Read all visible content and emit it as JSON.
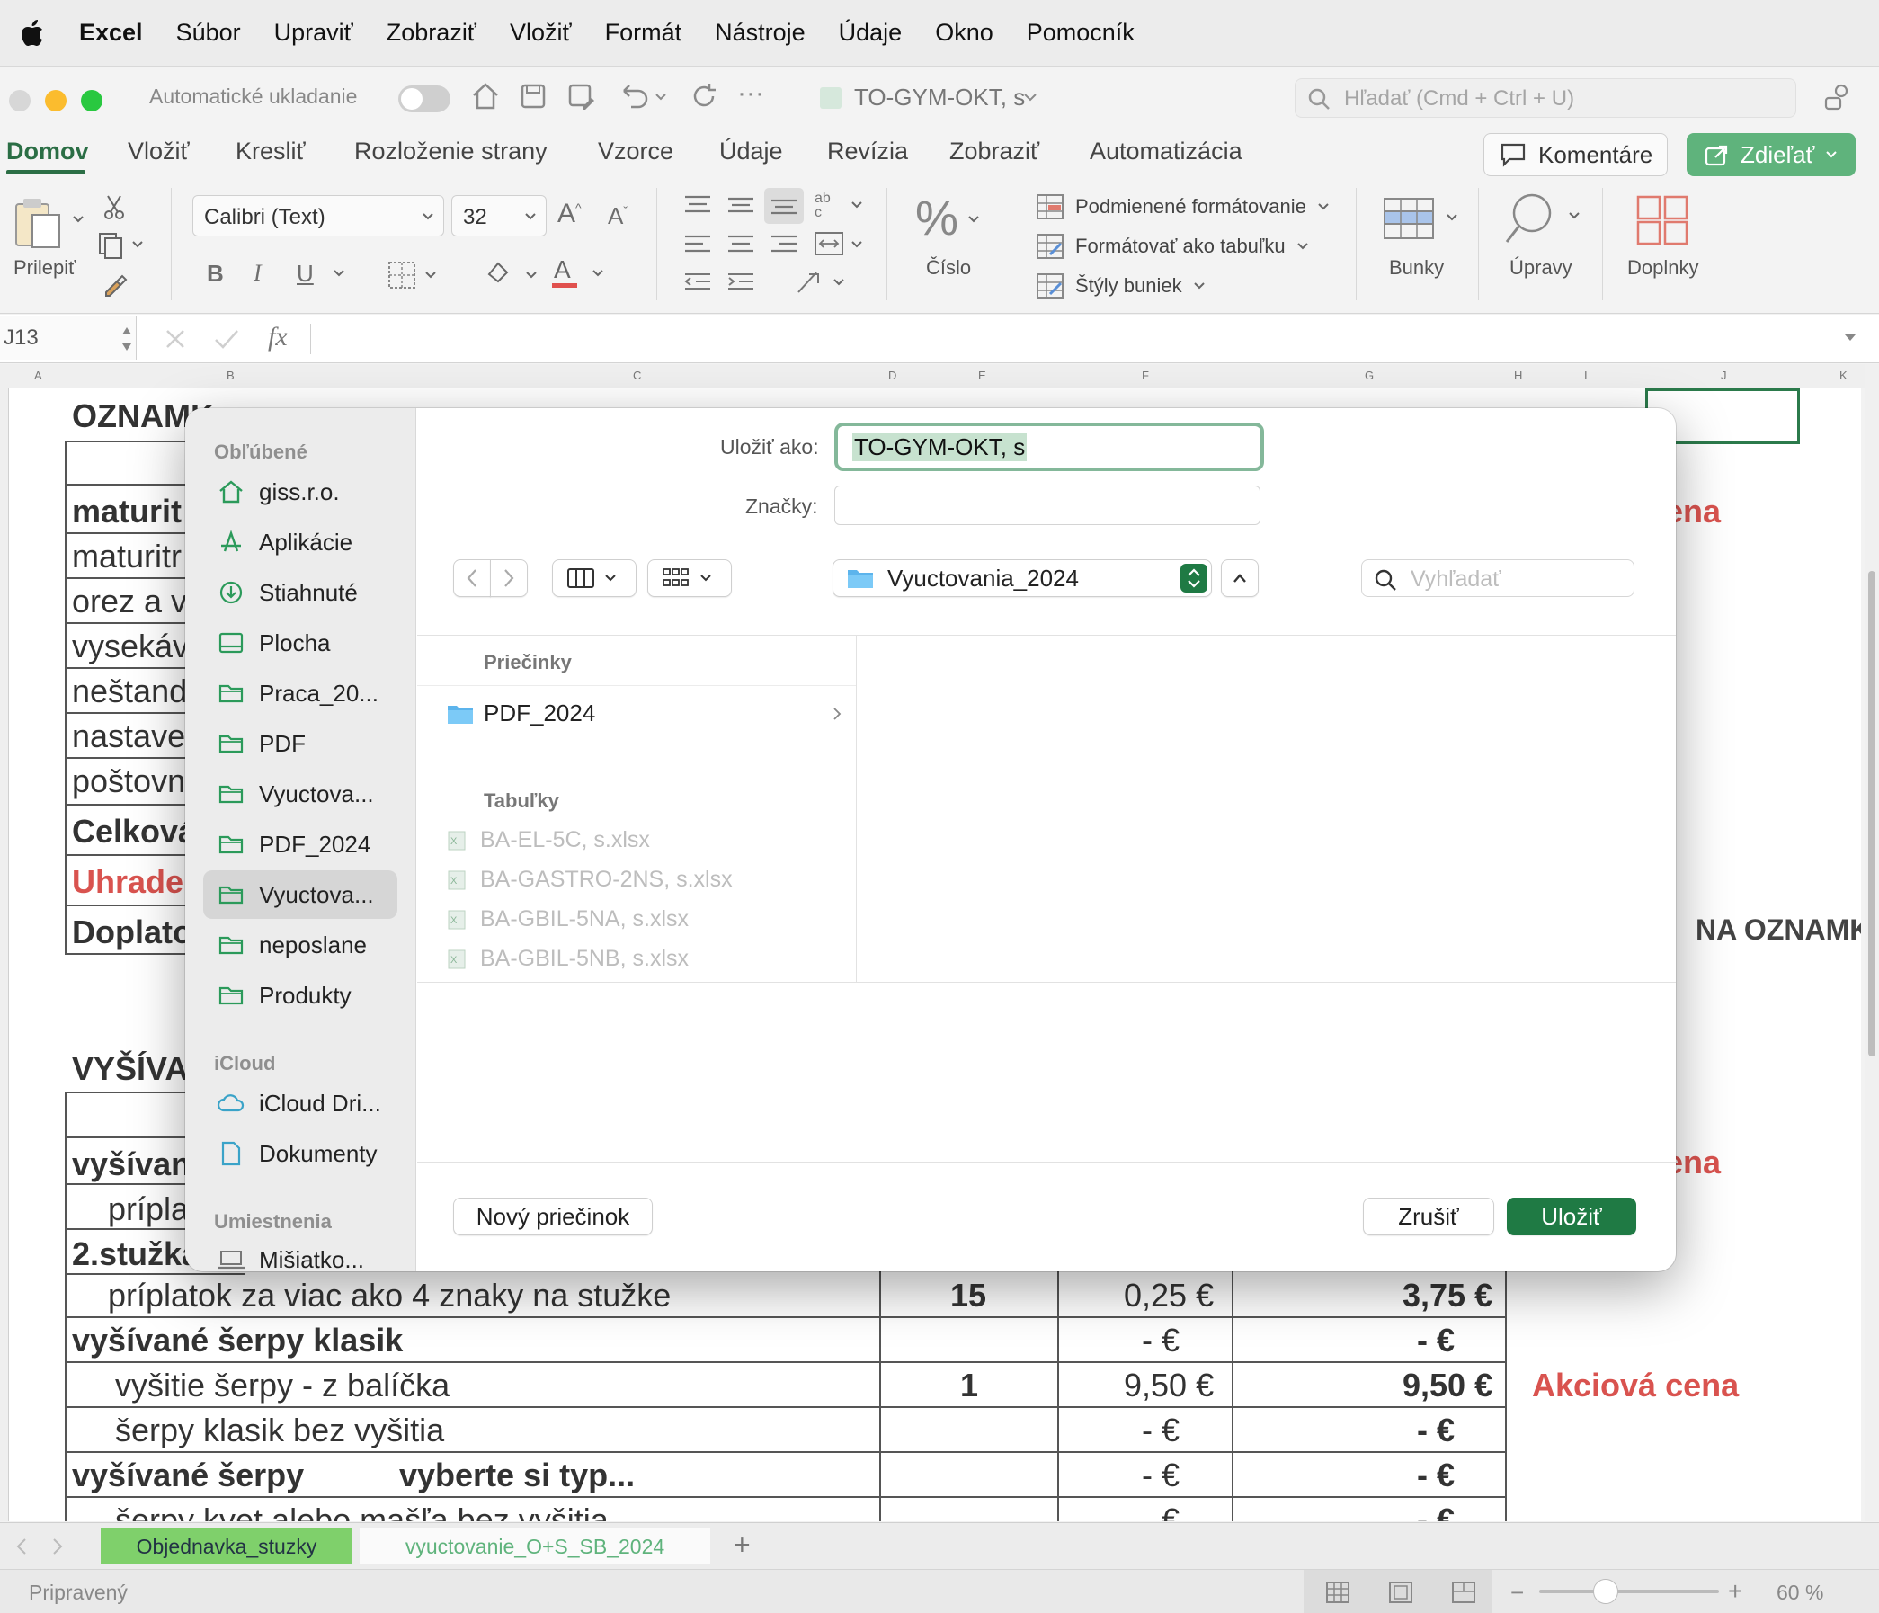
{
  "menubar": {
    "app": "Excel",
    "items": [
      "Súbor",
      "Upraviť",
      "Zobraziť",
      "Vložiť",
      "Formát",
      "Nástroje",
      "Údaje",
      "Okno",
      "Pomocník"
    ]
  },
  "titlebar": {
    "autosave_label": "Automatické ukladanie",
    "doc_title": "TO-GYM-OKT, s",
    "search_placeholder": "Hľadať (Cmd + Ctrl + U)"
  },
  "ribbon_tabs": [
    "Domov",
    "Vložiť",
    "Kresliť",
    "Rozloženie strany",
    "Vzorce",
    "Údaje",
    "Revízia",
    "Zobraziť",
    "Automatizácia"
  ],
  "ribbon": {
    "comments_label": "Komentáre",
    "share_label": "Zdieľať",
    "paste_label": "Prilepiť",
    "font_name": "Calibri (Text)",
    "font_size": "32",
    "number_label": "Číslo",
    "cond_format": "Podmienené formátovanie",
    "format_table": "Formátovať ako tabuľku",
    "cell_styles": "Štýly buniek",
    "cells_label": "Bunky",
    "edit_label": "Úpravy",
    "addins_label": "Doplnky",
    "bold": "B",
    "italic": "I",
    "underline": "U"
  },
  "formula_bar": {
    "cell_ref": "J13",
    "fx": "fx"
  },
  "columns": [
    "A",
    "B",
    "C",
    "D",
    "E",
    "F",
    "G",
    "H",
    "I",
    "J",
    "K"
  ],
  "sheet": {
    "title1": "OZNAMK",
    "left_rows": [
      "maturit",
      "maturitr",
      "orez a vl",
      "vysekáva",
      "neštand",
      "nastaver",
      "poštovn",
      "Celková",
      "Uhraden",
      "Doplato"
    ],
    "right_note1": "ena",
    "right_note2": "NA OZNAMK",
    "title2": "VYŠÍVA",
    "left_rows2": [
      "vyšívane",
      "prípla",
      "2.stužka"
    ],
    "right_note3": "ena",
    "rows": [
      {
        "label": "príplatok za viac ako 4 znaky na stužke",
        "qty": "15",
        "price": "0,25 €",
        "total": "3,75 €",
        "note": ""
      },
      {
        "label": "vyšívané šerpy klasik",
        "qty": "",
        "price": "-    €",
        "total": "-    €",
        "note": ""
      },
      {
        "label": "vyšitie šerpy - z balíčka",
        "qty": "1",
        "price": "9,50 €",
        "total": "9,50 €",
        "note": "Akciová cena"
      },
      {
        "label": "šerpy klasik bez vyšitia",
        "qty": "",
        "price": "-    €",
        "total": "-    €",
        "note": ""
      },
      {
        "label": "vyšívané šerpy",
        "label2": "vyberte si typ...",
        "qty": "",
        "price": "-    €",
        "total": "-    €",
        "note": ""
      },
      {
        "label": "šerpy kvet alebo mašľa bez vyšitia",
        "qty": "",
        "price": "-    €",
        "total": "-    €",
        "note": ""
      }
    ]
  },
  "sheet_tabs": [
    "Objednavka_stuzky",
    "vyuctovanie_O+S_SB_2024"
  ],
  "status": {
    "text": "Pripravený",
    "zoom": "60 %"
  },
  "dialog": {
    "save_as_label": "Uložiť ako:",
    "save_as_value": "TO-GYM-OKT, s",
    "tags_label": "Značky:",
    "location": "Vyuctovania_2024",
    "search_placeholder": "Vyhľadať",
    "sidebar": {
      "favorites_header": "Obľúbené",
      "favorites": [
        "giss.r.o.",
        "Aplikácie",
        "Stiahnuté",
        "Plocha",
        "Praca_20...",
        "PDF",
        "Vyuctova...",
        "PDF_2024",
        "Vyuctova...",
        "neposlane",
        "Produkty"
      ],
      "icloud_header": "iCloud",
      "icloud": [
        "iCloud Dri...",
        "Dokumenty"
      ],
      "locations_header": "Umiestnenia",
      "locations": [
        "Mišiatko..."
      ]
    },
    "folders_header": "Priečinky",
    "folders": [
      "PDF_2024"
    ],
    "tables_header": "Tabuľky",
    "files": [
      "BA-EL-5C, s.xlsx",
      "BA-GASTRO-2NS, s.xlsx",
      "BA-GBIL-5NA, s.xlsx",
      "BA-GBIL-5NB, s.xlsx"
    ],
    "new_folder": "Nový priečinok",
    "cancel": "Zrušiť",
    "save": "Uložiť"
  },
  "colors": {
    "accent": "#1f7a44",
    "tab_green": "#7fd06b",
    "red_text": "#d9534f"
  }
}
